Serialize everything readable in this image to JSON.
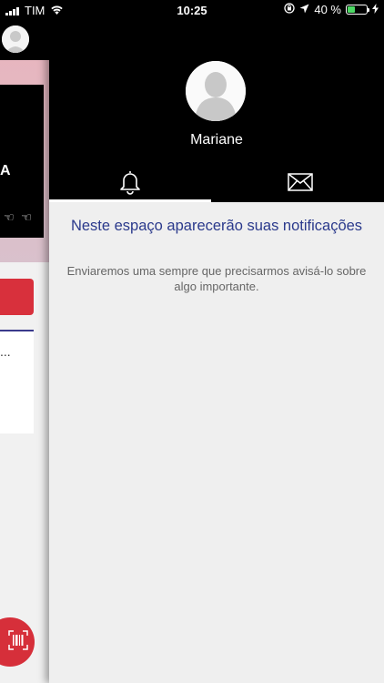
{
  "status_bar": {
    "carrier": "TIM",
    "time": "10:25",
    "battery_percent": "40 %",
    "battery_level": 0.4
  },
  "background_screen": {
    "card_text": "A",
    "card_icons": "☜ ☜",
    "list_text": "..."
  },
  "profile": {
    "name": "Mariane"
  },
  "tabs": [
    {
      "name": "notifications",
      "icon": "bell-icon",
      "active": true
    },
    {
      "name": "messages",
      "icon": "envelope-icon",
      "active": false
    }
  ],
  "notifications": {
    "empty_title": "Neste espaço aparecerão suas notificações",
    "empty_message": "Enviaremos uma sempre que precisarmos avisá-lo sobre algo importante."
  },
  "colors": {
    "accent_title": "#2b3a8c",
    "brand_red": "#d62f3a",
    "battery_green": "#4cd964"
  }
}
